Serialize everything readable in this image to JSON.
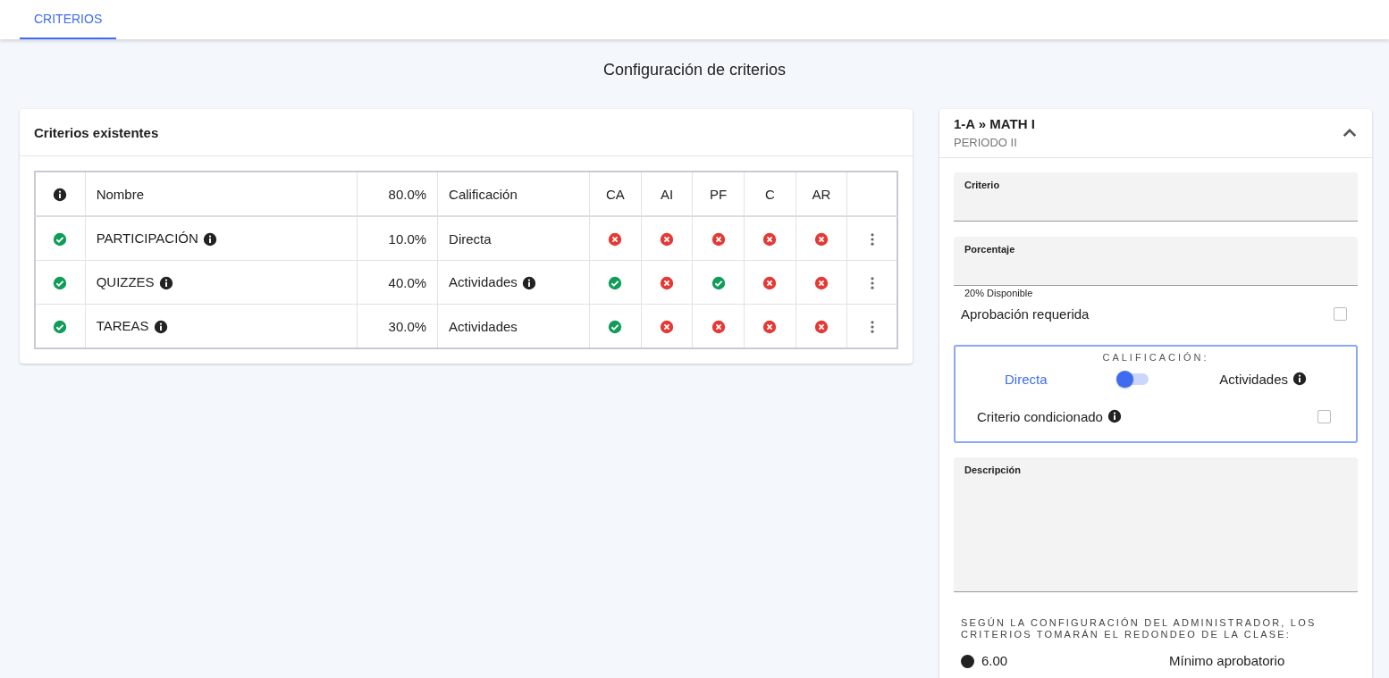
{
  "tabs": [
    {
      "label": "CRITERIOS",
      "selected": true
    }
  ],
  "page_title": "Configuración de criterios",
  "criteria_card": {
    "title": "Criterios existentes",
    "columns": [
      {
        "kind": "info"
      },
      {
        "kind": "text",
        "label": "Nombre"
      },
      {
        "kind": "num",
        "label": "80.0%"
      },
      {
        "kind": "text",
        "label": "Calificación"
      },
      {
        "kind": "flag",
        "label": "CA"
      },
      {
        "kind": "flag",
        "label": "AI"
      },
      {
        "kind": "flag",
        "label": "PF"
      },
      {
        "kind": "flag",
        "label": "C"
      },
      {
        "kind": "flag",
        "label": "AR"
      },
      {
        "kind": "menu"
      }
    ],
    "rows": [
      {
        "valid": true,
        "name": "PARTICIPACIÓN",
        "name_info": true,
        "percent": "10.0%",
        "grading": "Directa",
        "grading_info": false,
        "flags": [
          false,
          false,
          false,
          false,
          false
        ]
      },
      {
        "valid": true,
        "name": "QUIZZES",
        "name_info": true,
        "percent": "40.0%",
        "grading": "Actividades",
        "grading_info": true,
        "flags": [
          true,
          false,
          true,
          false,
          false
        ]
      },
      {
        "valid": true,
        "name": "TAREAS",
        "name_info": true,
        "percent": "30.0%",
        "grading": "Actividades",
        "grading_info": false,
        "flags": [
          true,
          false,
          false,
          false,
          false
        ]
      }
    ]
  },
  "form_panel": {
    "title": "1-A » MATH I",
    "subtitle": "PERIODO II",
    "expanded": true,
    "criterion_field": {
      "label": "Criterio"
    },
    "percent_field": {
      "label": "Porcentaje",
      "hint": "20% Disponible"
    },
    "approval": {
      "label": "Aprobación requerida",
      "checked": false
    },
    "grading": {
      "title": "CALIFICACIÓN:",
      "on": false,
      "options": [
        {
          "label": "Directa",
          "selected": true,
          "info": false
        },
        {
          "label": "Actividades",
          "selected": false,
          "info": true
        }
      ],
      "conditioned": {
        "label": "Criterio condicionado",
        "checked": false
      }
    },
    "description_field": {
      "label": "Descripción"
    },
    "rounding_note": "SEGÚN LA CONFIGURACIÓN DEL ADMINISTRADOR, LOS CRITERIOS TOMARÁN EL REDONDEO DE LA CLASE:",
    "passing": {
      "value": "6.00",
      "label": "Mínimo aprobatorio"
    }
  }
}
